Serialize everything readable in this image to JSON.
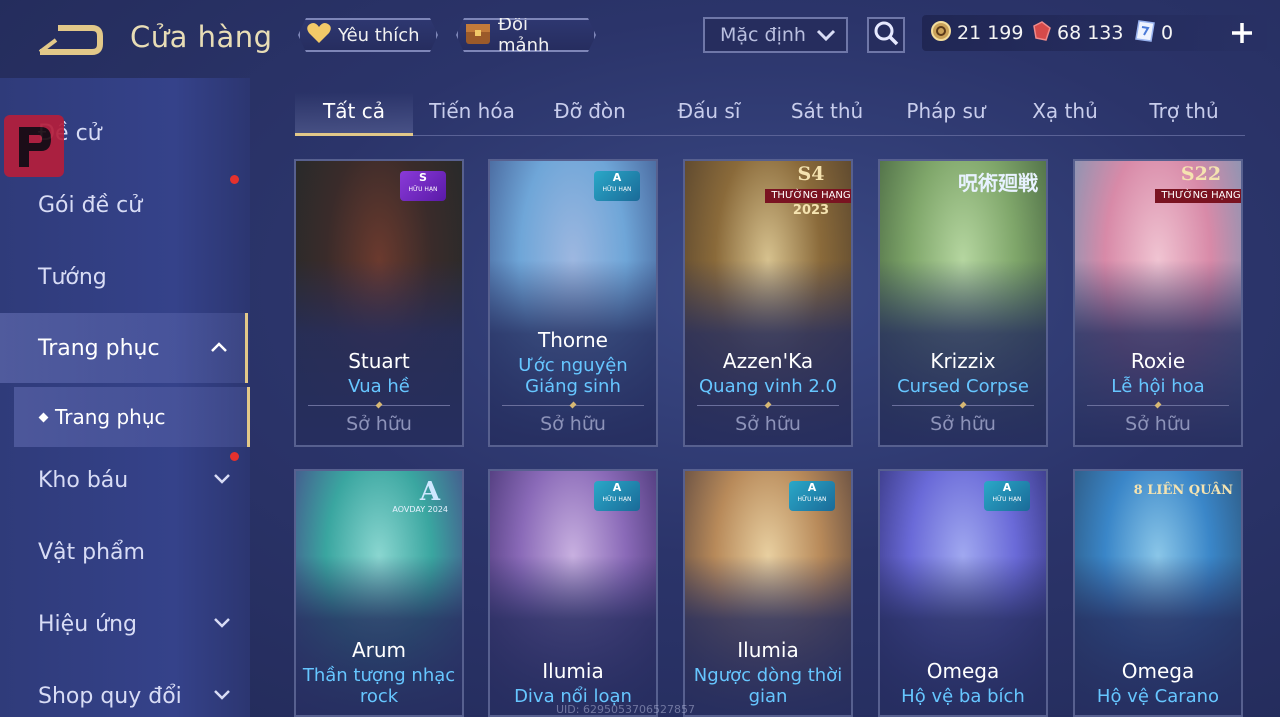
{
  "header": {
    "title": "Cửa hàng",
    "favorites_label": "Yêu thích",
    "shards_label": "Đổi mảnh",
    "sort_selected": "Mặc định",
    "currencies": [
      {
        "icon": "gold-coin-icon",
        "value": "21 199"
      },
      {
        "icon": "red-gem-icon",
        "value": "68 133"
      },
      {
        "icon": "voucher-icon",
        "value": "0"
      }
    ]
  },
  "sidebar": {
    "items": [
      {
        "label": "Đề cử"
      },
      {
        "label": "Gói đề cử"
      },
      {
        "label": "Tướng"
      },
      {
        "label": "Trang phục"
      },
      {
        "label": "Kho báu"
      },
      {
        "label": "Vật phẩm"
      },
      {
        "label": "Hiệu ứng"
      },
      {
        "label": "Shop quy đổi"
      }
    ],
    "sub_item": "Trang phục"
  },
  "tabs": [
    "Tất cả",
    "Tiến hóa",
    "Đỡ đòn",
    "Đấu sĩ",
    "Sát thủ",
    "Pháp sư",
    "Xạ thủ",
    "Trợ thủ"
  ],
  "cards": [
    {
      "hero": "Stuart",
      "skin": "Vua hề",
      "owned": "Sở hữu",
      "tier": "S",
      "tier_sub": "HỮU HẠN",
      "colors": [
        "#3a2b2a",
        "#6b3a2e",
        "#1f2a2a"
      ]
    },
    {
      "hero": "Thorne",
      "skin": "Ước nguyện Giáng sinh",
      "owned": "Sở hữu",
      "tier": "A",
      "tier_sub": "HỮU HẠN",
      "colors": [
        "#6fa6d8",
        "#9db7e0",
        "#3a4f86"
      ]
    },
    {
      "hero": "Azzen'Ka",
      "skin": "Quang vinh 2.0",
      "owned": "Sở hữu",
      "banner_top": "S4",
      "banner_mid": "THƯỜNG HẠNG",
      "banner_bot": "2023",
      "colors": [
        "#8a6a3a",
        "#d6c18e",
        "#4a3a2a"
      ]
    },
    {
      "hero": "Krizzix",
      "skin": "Cursed Corpse",
      "owned": "Sở hữu",
      "event": "呪術廻戦",
      "colors": [
        "#7fa66a",
        "#b5d6a0",
        "#3d5a3a"
      ]
    },
    {
      "hero": "Roxie",
      "skin": "Lễ hội hoa",
      "owned": "Sở hữu",
      "banner_top": "S22",
      "banner_mid": "THƯỜNG HẠNG",
      "colors": [
        "#d88aa8",
        "#f0c4d2",
        "#6a9ab8"
      ]
    },
    {
      "hero": "Arum",
      "skin": "Thần tượng nhạc rock",
      "event": "A",
      "event_sub": "AOVDAY 2024",
      "colors": [
        "#3aa6a0",
        "#8ad6d0",
        "#4a3a86"
      ]
    },
    {
      "hero": "Ilumia",
      "skin": "Diva nổi loạn",
      "tier": "A",
      "tier_sub": "HỮU HẠN",
      "colors": [
        "#8a6ab8",
        "#c8b0e0",
        "#3a2a66"
      ]
    },
    {
      "hero": "Ilumia",
      "skin": "Ngược dòng thời gian",
      "tier": "A",
      "tier_sub": "HỮU HẠN",
      "colors": [
        "#b88a5a",
        "#e8cfa0",
        "#4a3a3a"
      ]
    },
    {
      "hero": "Omega",
      "skin": "Hộ vệ ba bích",
      "tier": "A",
      "tier_sub": "HỮU HẠN",
      "colors": [
        "#6a6ad8",
        "#a0a8f0",
        "#2a2a6a"
      ]
    },
    {
      "hero": "Omega",
      "skin": "Hộ vệ Carano",
      "event": "8 LIÊN QUÂN",
      "colors": [
        "#3a86c8",
        "#8ac6e8",
        "#2a4a6a"
      ]
    }
  ],
  "uid_text": "UID: 6295053706527857"
}
